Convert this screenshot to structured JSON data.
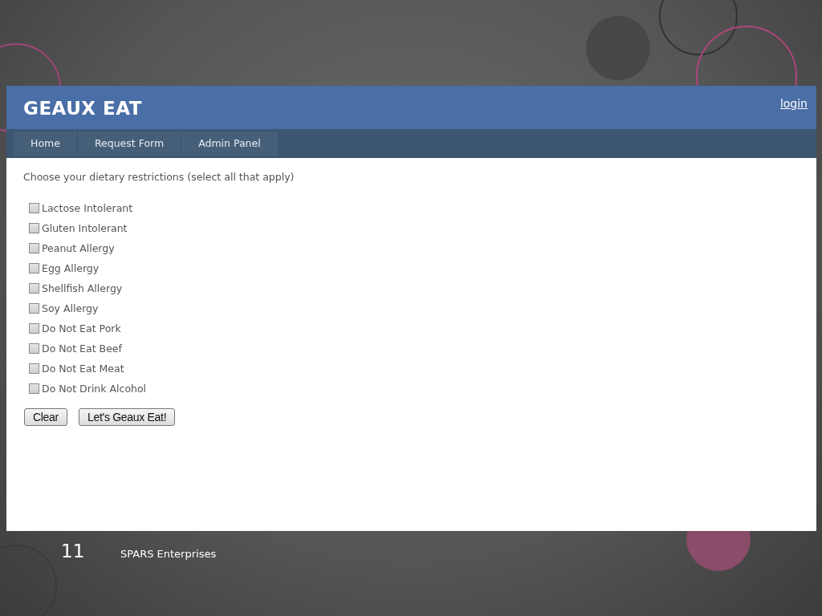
{
  "site": {
    "title": "GEAUX EAT",
    "login": "login"
  },
  "nav": [
    {
      "label": "Home"
    },
    {
      "label": "Request Form"
    },
    {
      "label": "Admin Panel"
    }
  ],
  "form": {
    "prompt": "Choose your dietary restrictions (select all that apply)",
    "options": [
      {
        "label": "Lactose Intolerant",
        "checked": false
      },
      {
        "label": "Gluten Intolerant",
        "checked": false
      },
      {
        "label": "Peanut Allergy",
        "checked": false
      },
      {
        "label": "Egg Allergy",
        "checked": false
      },
      {
        "label": "Shellfish Allergy",
        "checked": false
      },
      {
        "label": "Soy Allergy",
        "checked": false
      },
      {
        "label": "Do Not Eat Pork",
        "checked": false
      },
      {
        "label": "Do Not Eat Beef",
        "checked": false
      },
      {
        "label": "Do Not Eat Meat",
        "checked": false
      },
      {
        "label": "Do Not Drink Alcohol",
        "checked": false
      }
    ],
    "buttons": [
      "Clear",
      "Let's Geaux Eat!"
    ]
  },
  "slide_footer": {
    "number": "11",
    "text": "SPARS Enterprises"
  }
}
